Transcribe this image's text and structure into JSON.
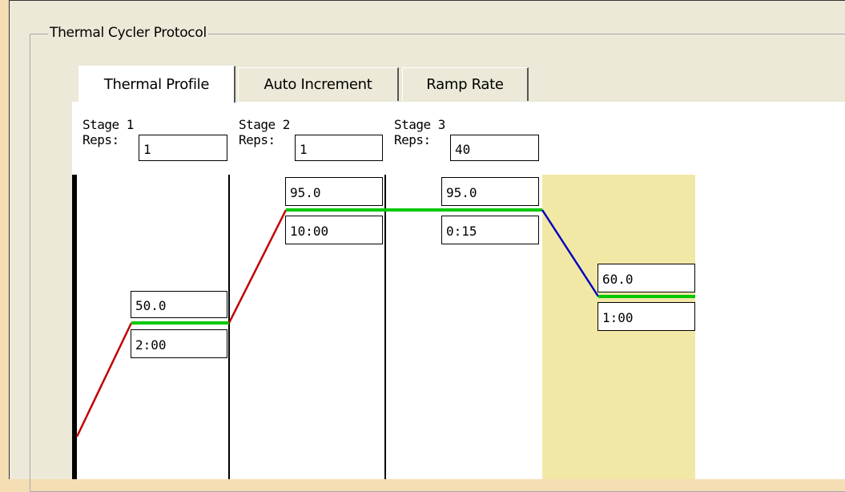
{
  "group_title": "Thermal Cycler Protocol",
  "tabs": [
    {
      "label": "Thermal Profile",
      "active": true
    },
    {
      "label": "Auto Increment",
      "active": false
    },
    {
      "label": "Ramp Rate",
      "active": false
    }
  ],
  "reps_label": "Reps:",
  "stages": [
    {
      "name": "Stage 1",
      "reps": "1"
    },
    {
      "name": "Stage 2",
      "reps": "1"
    },
    {
      "name": "Stage 3",
      "reps": "40"
    }
  ],
  "steps": [
    {
      "temp": "50.0",
      "time": "2:00"
    },
    {
      "temp": "95.0",
      "time": "10:00"
    },
    {
      "temp": "95.0",
      "time": "0:15"
    },
    {
      "temp": "60.0",
      "time": "1:00"
    }
  ],
  "colors": {
    "hold_line": "#00C800",
    "ramp_up": "#C00000",
    "ramp_down": "#0000C0",
    "selected_step_bg": "#F2E8A6",
    "stage_divider": "#000000",
    "background": "#F5DDB4"
  }
}
